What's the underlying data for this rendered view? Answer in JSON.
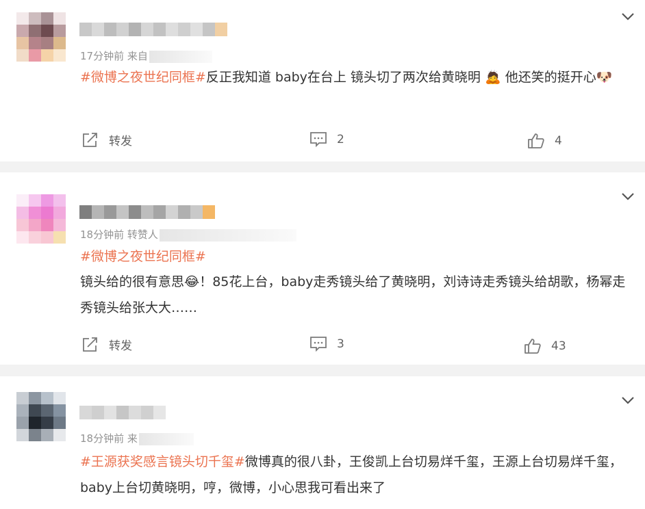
{
  "posts": [
    {
      "meta_time": "17分钟前",
      "meta_source": "来自",
      "hashtag": "#微博之夜世纪同框#",
      "body": "反正我知道 baby在台上 镜头切了两次给黄晓明",
      "emoji1": "🙇",
      "body2": " 他还笑的挺开心",
      "emoji2": "🐶",
      "repost_label": "转发",
      "comment_count": "2",
      "like_count": "4"
    },
    {
      "meta_time": "18分钟前",
      "meta_source": "转赞人",
      "hashtag": "#微博之夜世纪同框#",
      "body_a": "镜头给的很有意思",
      "emoji1": "😂",
      "body_b": "！85花上台，baby走秀镜头给了黄晓明，刘诗诗走秀镜头给胡歌，杨幂走秀镜头给张大大……",
      "repost_label": "转发",
      "comment_count": "3",
      "like_count": "43"
    },
    {
      "meta_time": "18分钟前",
      "meta_source": "来",
      "hashtag": "#王源获奖感言镜头切千玺#",
      "body": "微博真的很八卦，王俊凯上台切易烊千玺，王源上台切易烊千玺，baby上台切黄晓明，哼，微博，小心思我可看出来了"
    }
  ],
  "icons": {
    "more": "chevron-down-icon",
    "repost": "repost-icon",
    "comment": "comment-icon",
    "like": "thumbs-up-icon"
  },
  "colors": {
    "hashtag": "#eb7350",
    "meta": "#939393",
    "action": "#636363",
    "separator": "#f2f2f2"
  }
}
